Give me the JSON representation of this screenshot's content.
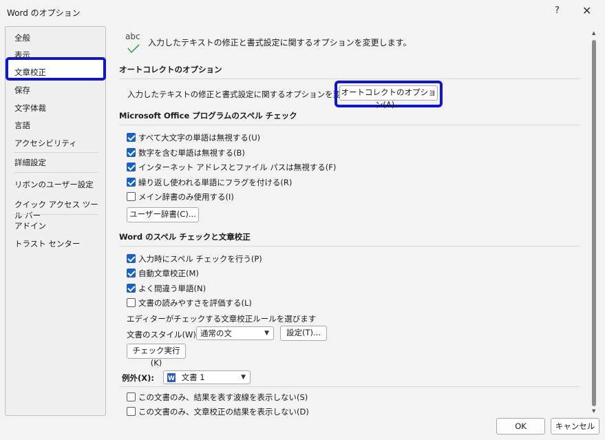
{
  "window": {
    "title": "Word のオプション",
    "help": "?",
    "close": "✕"
  },
  "sidebar": {
    "items": [
      {
        "label": "全般"
      },
      {
        "label": "表示"
      },
      {
        "label": "文章校正"
      },
      {
        "label": "保存"
      },
      {
        "label": "文字体裁"
      },
      {
        "label": "言語"
      },
      {
        "label": "アクセシビリティ"
      },
      {
        "label": "詳細設定"
      },
      {
        "label": "リボンのユーザー設定"
      },
      {
        "label": "クイック アクセス ツール バー"
      },
      {
        "label": "アドイン"
      },
      {
        "label": "トラスト センター"
      }
    ],
    "selected": "文章校正"
  },
  "header": {
    "icon_text": "abc",
    "text": "入力したテキストの修正と書式設定に関するオプションを変更します。"
  },
  "autocorrect": {
    "title": "オートコレクトのオプション",
    "description": "入力したテキストの修正と書式設定に関するオプションを変更します。",
    "button": "オートコレクトのオプション(A)..."
  },
  "office_spell": {
    "title": "Microsoft Office プログラムのスペル チェック",
    "options": [
      {
        "label": "すべて大文字の単語は無視する(U)",
        "checked": true
      },
      {
        "label": "数字を含む単語は無視する(B)",
        "checked": true
      },
      {
        "label": "インターネット アドレスとファイル パスは無視する(F)",
        "checked": true
      },
      {
        "label": "繰り返し使われる単語にフラグを付ける(R)",
        "checked": true
      },
      {
        "label": "メイン辞書のみ使用する(I)",
        "checked": false
      }
    ],
    "dict_button": "ユーザー辞書(C)..."
  },
  "word_spell": {
    "title": "Word のスペル チェックと文章校正",
    "options": [
      {
        "label": "入力時にスペル チェックを行う(P)",
        "checked": true
      },
      {
        "label": "自動文章校正(M)",
        "checked": true
      },
      {
        "label": "よく間違う単語(N)",
        "checked": true
      },
      {
        "label": "文書の読みやすさを評価する(L)",
        "checked": false
      }
    ],
    "rules_text": "エディターがチェックする文章校正ルールを選びます",
    "style_label": "文書のスタイル(W):",
    "style_value": "通常の文",
    "settings_button": "設定(T)...",
    "check_button": "チェック実行(K)"
  },
  "exceptions": {
    "label": "例外(X):",
    "value": "文書 1",
    "options": [
      {
        "label": "この文書のみ、結果を表す波線を表示しない(S)",
        "checked": false
      },
      {
        "label": "この文書のみ、文章校正の結果を表示しない(D)",
        "checked": false
      }
    ]
  },
  "footer": {
    "ok": "OK",
    "cancel": "キャンセル"
  },
  "colors": {
    "accent": "#1863c2",
    "highlight": "#0f17c9"
  }
}
